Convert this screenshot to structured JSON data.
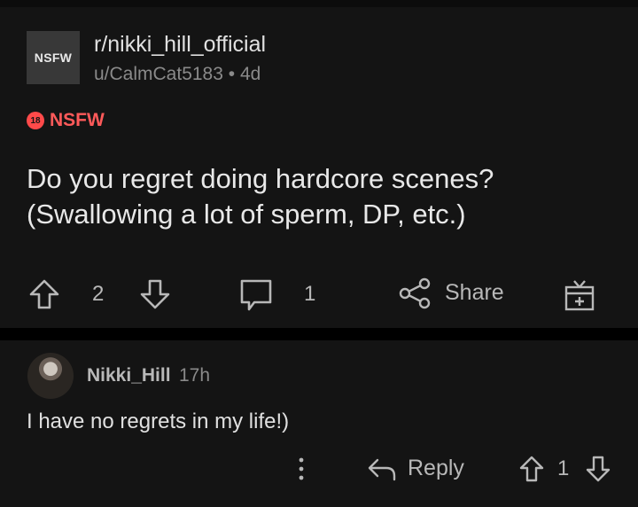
{
  "post": {
    "community_avatar_text": "NSFW",
    "community": "r/nikki_hill_official",
    "author": "u/CalmCat5183",
    "separator": "•",
    "age": "4d",
    "nsfw_badge": "18",
    "nsfw_label": "NSFW",
    "title_line1": "Do you regret doing hardcore scenes?",
    "title_line2": "(Swallowing a lot of sperm, DP, etc.)",
    "upvotes": "2",
    "comments": "1",
    "share_label": "Share",
    "icons": [
      "arrow-up-icon",
      "arrow-down-icon",
      "comment-icon",
      "share-icon",
      "gift-icon"
    ]
  },
  "comment": {
    "username": "Nikki_Hill",
    "age": "17h",
    "text": "I have no regrets in my life!)",
    "reply_label": "Reply",
    "score": "1",
    "icons": [
      "more-vertical-icon",
      "reply-arrow-icon",
      "arrow-up-icon",
      "arrow-down-icon"
    ]
  },
  "colors": {
    "background": "#141414",
    "nsfw_red": "#ff5a5a",
    "text_primary": "#e0e0e0",
    "text_secondary": "#8a8a8a"
  }
}
